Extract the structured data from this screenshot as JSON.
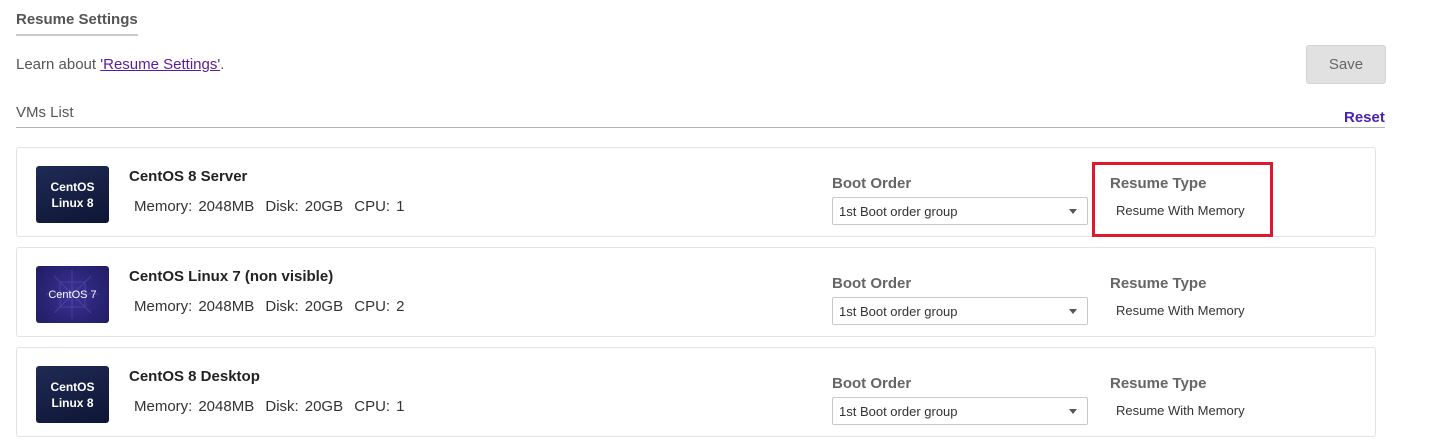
{
  "section": {
    "title": "Resume Settings",
    "learn_prefix": "Learn about ",
    "learn_link": "'Resume Settings'",
    "learn_suffix": "."
  },
  "toolbar": {
    "save_label": "Save",
    "reset_label": "Reset"
  },
  "vms_list": {
    "label": "VMs List",
    "field_labels": {
      "boot_order": "Boot Order",
      "resume_type": "Resume Type",
      "memory_prefix": "Memory:",
      "disk_prefix": "Disk:",
      "cpu_prefix": "CPU:"
    },
    "items": [
      {
        "name": "CentOS 8 Server",
        "logo_line1": "CentOS",
        "logo_line2": "Linux 8",
        "memory": "2048MB",
        "disk": "20GB",
        "cpu": "1",
        "boot_order": "1st Boot order group",
        "resume_type": "Resume With Memory",
        "highlighted": true
      },
      {
        "name": "CentOS Linux 7 (non visible)",
        "logo_line1": "CentOS 7",
        "logo_line2": "",
        "memory": "2048MB",
        "disk": "20GB",
        "cpu": "2",
        "boot_order": "1st Boot order group",
        "resume_type": "Resume With Memory",
        "highlighted": false
      },
      {
        "name": "CentOS 8 Desktop",
        "logo_line1": "CentOS",
        "logo_line2": "Linux 8",
        "memory": "2048MB",
        "disk": "20GB",
        "cpu": "1",
        "boot_order": "1st Boot order group",
        "resume_type": "Resume With Memory",
        "highlighted": false
      }
    ]
  },
  "colors": {
    "link": "#5b1c9a",
    "reset": "#4a22b0",
    "highlight": "#e0182b"
  }
}
